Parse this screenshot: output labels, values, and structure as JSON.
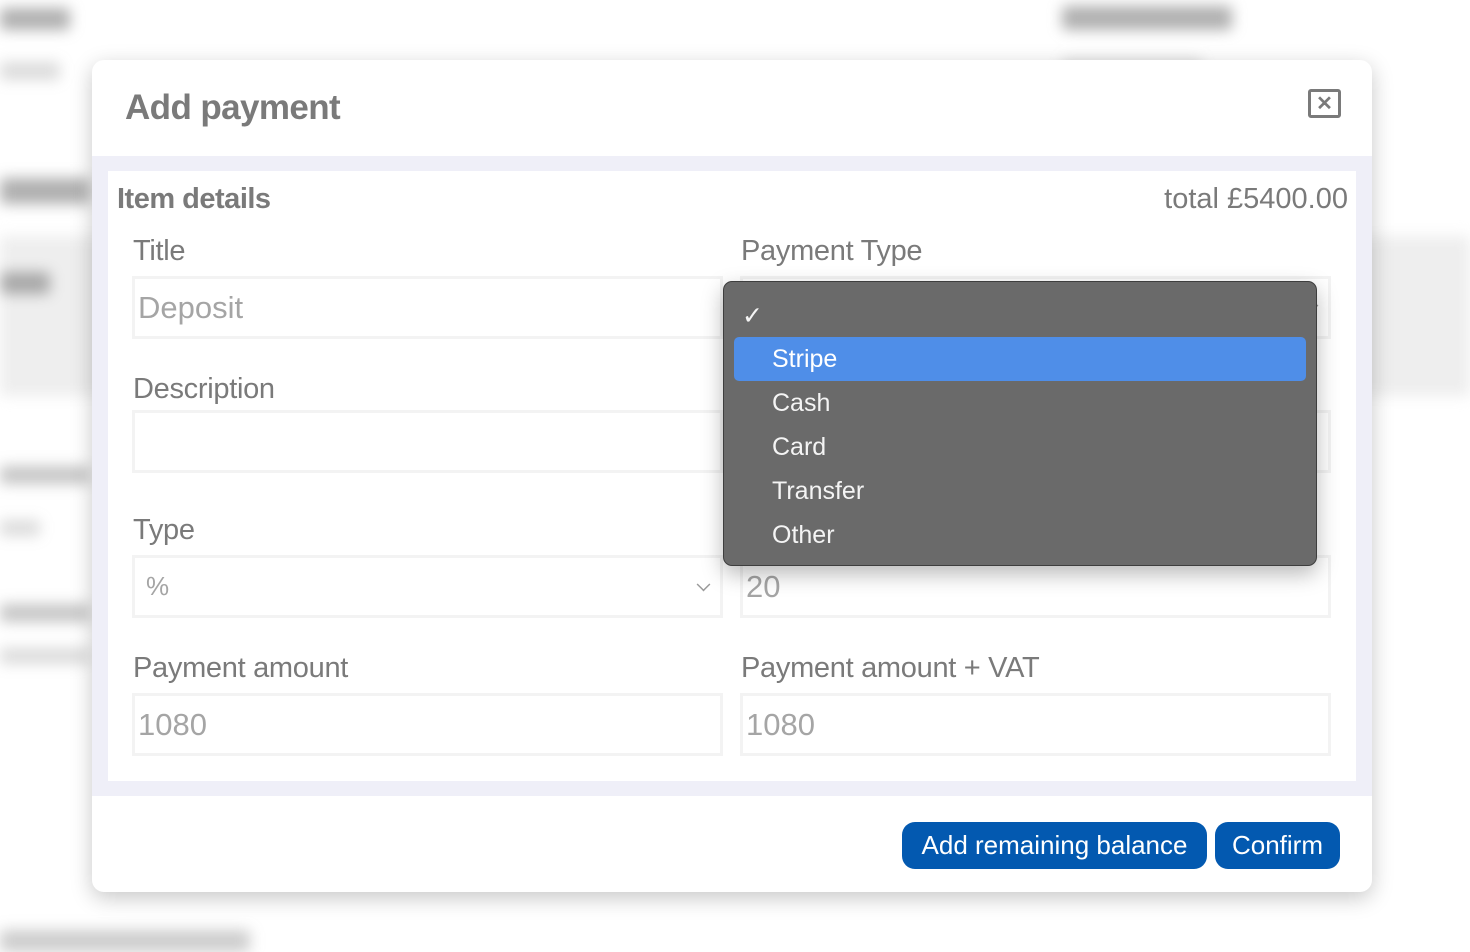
{
  "modal": {
    "title": "Add payment",
    "close_icon": "close-icon (x in square)"
  },
  "item_details": {
    "heading": "Item details",
    "total_label": "total £5400.00",
    "fields": {
      "title": {
        "label": "Title",
        "value": "Deposit"
      },
      "payment_type": {
        "label": "Payment Type",
        "value": ""
      },
      "description": {
        "label": "Description",
        "value": ""
      },
      "type": {
        "label": "Type",
        "value": "%"
      },
      "amount": {
        "value": "20"
      },
      "payment_amount": {
        "label": "Payment amount",
        "value": "1080"
      },
      "payment_amount_vat": {
        "label": "Payment amount + VAT",
        "value": "1080"
      }
    }
  },
  "payment_type_dropdown": {
    "checked_option": "",
    "highlighted_option": "Stripe",
    "options": [
      "",
      "Stripe",
      "Cash",
      "Card",
      "Transfer",
      "Other"
    ],
    "check_glyph": "✓"
  },
  "footer": {
    "add_remaining_label": "Add remaining balance",
    "confirm_label": "Confirm"
  },
  "colors": {
    "primary_button": "#0359b0",
    "dropdown_highlight": "#4f8ee8",
    "dropdown_bg": "#6a6a6a",
    "body_band": "#efeff8"
  }
}
